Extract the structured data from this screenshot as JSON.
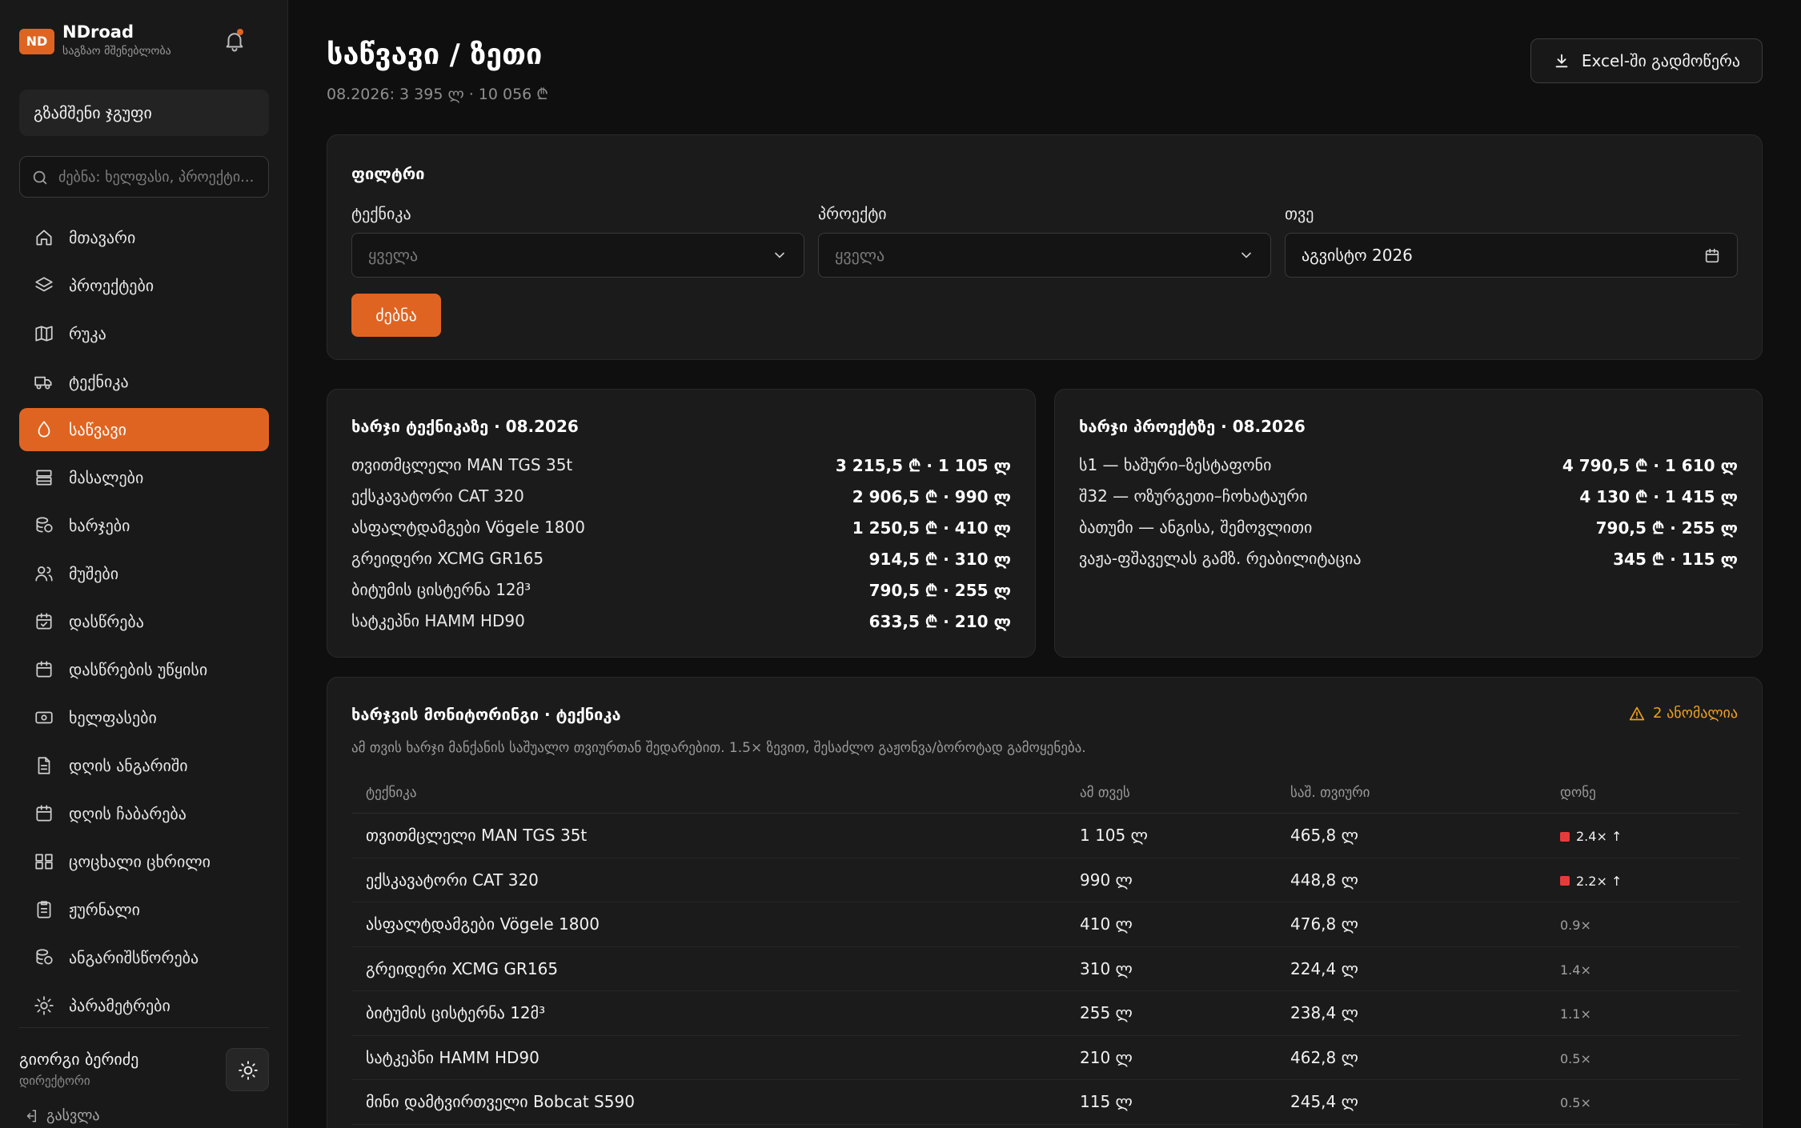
{
  "brand": {
    "badge": "ND",
    "name": "NDroad",
    "subtitle": "საგზაო მშენებლობა"
  },
  "sidebar": {
    "group_button": "გზამშენი ჯგუფი",
    "search_placeholder": "ძებნა: ხელფასი, პროექტი...",
    "items": [
      {
        "label": "მთავარი",
        "icon": "home-icon"
      },
      {
        "label": "პროექტები",
        "icon": "layers-icon"
      },
      {
        "label": "რუკა",
        "icon": "map-icon"
      },
      {
        "label": "ტექნიკა",
        "icon": "truck-icon"
      },
      {
        "label": "საწვავი",
        "icon": "fuel-drop-icon",
        "active": true
      },
      {
        "label": "მასალები",
        "icon": "materials-icon"
      },
      {
        "label": "ხარჯები",
        "icon": "coins-icon"
      },
      {
        "label": "მუშები",
        "icon": "workers-icon"
      },
      {
        "label": "დასწრება",
        "icon": "calendar-check-icon"
      },
      {
        "label": "დასწრების უწყისი",
        "icon": "calendar-icon"
      },
      {
        "label": "ხელფასები",
        "icon": "banknote-icon"
      },
      {
        "label": "დღის ანგარიში",
        "icon": "document-icon"
      },
      {
        "label": "დღის ჩაბარება",
        "icon": "calendar-icon"
      },
      {
        "label": "ცოცხალი ცხრილი",
        "icon": "grid-icon"
      },
      {
        "label": "ჟურნალი",
        "icon": "clipboard-icon"
      },
      {
        "label": "ანგარიშსწორება",
        "icon": "coins-icon"
      },
      {
        "label": "პარამეტრები",
        "icon": "settings-icon"
      }
    ],
    "user": {
      "name": "გიორგი ბერიძე",
      "role": "დირექტორი"
    },
    "logout": "გასვლა"
  },
  "header": {
    "title": "საწვავი / ზეთი",
    "subtitle": "08.2026: 3 395 ლ · 10 056 ₾",
    "export_label": "Excel-ში გადმოწერა"
  },
  "filter": {
    "title": "ფილტრი",
    "equipment_label": "ტექნიკა",
    "equipment_value": "ყველა",
    "project_label": "პროექტი",
    "project_value": "ყველა",
    "month_label": "თვე",
    "month_value": "აგვისტო 2026",
    "search_button": "ძებნა"
  },
  "cost_by_equipment": {
    "title": "ხარჯი ტექნიკაზე · 08.2026",
    "rows": [
      {
        "name": "თვითმცლელი MAN TGS 35t",
        "value": "3 215,5 ₾ · 1 105 ლ"
      },
      {
        "name": "ექსკავატორი CAT 320",
        "value": "2 906,5 ₾ · 990 ლ"
      },
      {
        "name": "ასფალტდამგები Vögele 1800",
        "value": "1 250,5 ₾ · 410 ლ"
      },
      {
        "name": "გრეიდერი XCMG GR165",
        "value": "914,5 ₾ · 310 ლ"
      },
      {
        "name": "ბიტუმის ცისტერნა 12მ³",
        "value": "790,5 ₾ · 255 ლ"
      },
      {
        "name": "სატკეპნი HAMM HD90",
        "value": "633,5 ₾ · 210 ლ"
      }
    ]
  },
  "cost_by_project": {
    "title": "ხარჯი პროექტზე · 08.2026",
    "rows": [
      {
        "name": "ს1 — ხაშური–ზესტაფონი",
        "value": "4 790,5 ₾ · 1 610 ლ"
      },
      {
        "name": "შ32 — ოზურგეთი–ჩოხატაური",
        "value": "4 130 ₾ · 1 415 ლ"
      },
      {
        "name": "ბათუმი — ანგისა, შემოვლითი",
        "value": "790,5 ₾ · 255 ლ"
      },
      {
        "name": "ვაჟა-ფშაველას გამზ. რეაბილიტაცია",
        "value": "345 ₾ · 115 ლ"
      }
    ]
  },
  "monitoring": {
    "title": "ხარჯვის მონიტორინგი · ტექნიკა",
    "anomaly_label": "2 ანომალია",
    "description": "ამ თვის ხარჯი მანქანის საშუალო თვიურთან შედარებით. 1.5× ზევით, შესაძლო გაჟონვა/ბოროტად გამოყენება.",
    "columns": [
      "ტექნიკა",
      "ამ თვეს",
      "საშ. თვიური",
      "დონე"
    ],
    "rows": [
      {
        "name": "თვითმცლელი MAN TGS 35t",
        "this_month": "1 105 ლ",
        "avg": "465,8 ლ",
        "level": "2.4× ↑",
        "anomaly": true
      },
      {
        "name": "ექსკავატორი CAT 320",
        "this_month": "990 ლ",
        "avg": "448,8 ლ",
        "level": "2.2× ↑",
        "anomaly": true
      },
      {
        "name": "ასფალტდამგები Vögele 1800",
        "this_month": "410 ლ",
        "avg": "476,8 ლ",
        "level": "0.9×",
        "anomaly": false
      },
      {
        "name": "გრეიდერი XCMG GR165",
        "this_month": "310 ლ",
        "avg": "224,4 ლ",
        "level": "1.4×",
        "anomaly": false
      },
      {
        "name": "ბიტუმის ცისტერნა 12მ³",
        "this_month": "255 ლ",
        "avg": "238,4 ლ",
        "level": "1.1×",
        "anomaly": false
      },
      {
        "name": "სატკეპნი HAMM HD90",
        "this_month": "210 ლ",
        "avg": "462,8 ლ",
        "level": "0.5×",
        "anomaly": false
      },
      {
        "name": "მინი დამტვირთველი Bobcat S590",
        "this_month": "115 ლ",
        "avg": "245,4 ლ",
        "level": "0.5×",
        "anomaly": false
      }
    ]
  },
  "colors": {
    "accent": "#e06421",
    "anomaly": "#e63b3b",
    "warning": "#f0a020"
  }
}
